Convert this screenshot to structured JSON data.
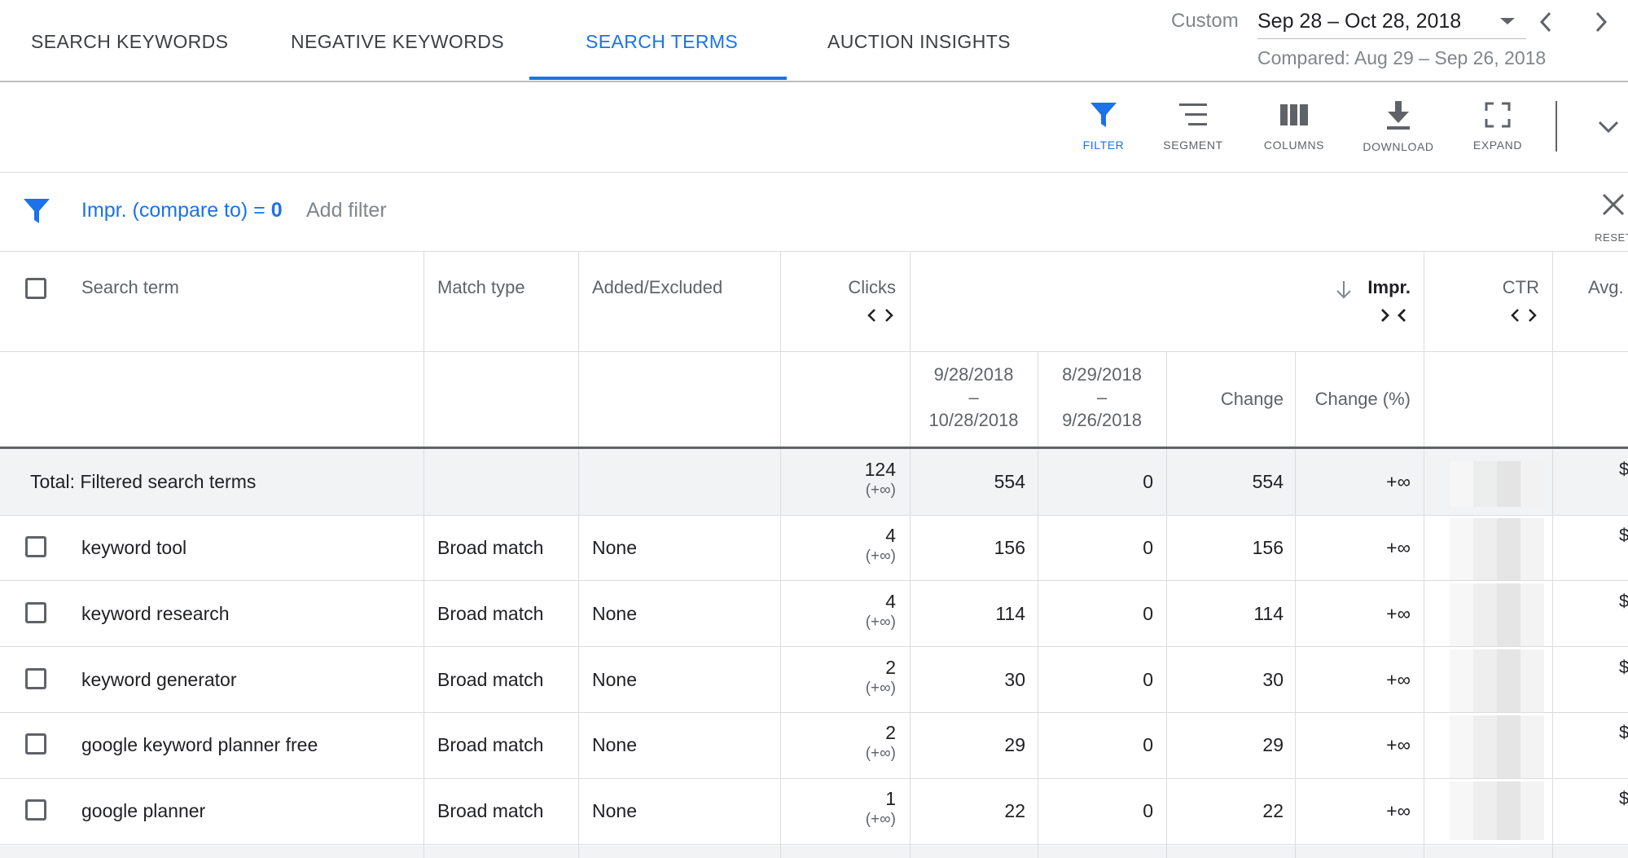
{
  "tabs": [
    {
      "label": "SEARCH KEYWORDS",
      "active": false
    },
    {
      "label": "NEGATIVE KEYWORDS",
      "active": false
    },
    {
      "label": "SEARCH TERMS",
      "active": true
    },
    {
      "label": "AUCTION INSIGHTS",
      "active": false
    }
  ],
  "date": {
    "preset": "Custom",
    "range": "Sep 28 – Oct 28, 2018",
    "compared": "Compared: Aug 29 – Sep 26, 2018"
  },
  "toolbar": {
    "filter": "FILTER",
    "segment": "SEGMENT",
    "columns": "COLUMNS",
    "download": "DOWNLOAD",
    "expand": "EXPAND"
  },
  "filter_bar": {
    "chip_prefix": "Impr. (compare to) = ",
    "chip_value": "0",
    "add_filter": "Add filter",
    "reset": "RESET"
  },
  "table": {
    "headers": {
      "search_term": "Search term",
      "match_type": "Match type",
      "added_excluded": "Added/Excluded",
      "clicks": "Clicks",
      "impr": "Impr.",
      "ctr": "CTR",
      "avg": "Avg."
    },
    "subheaders": {
      "current_start": "9/28/2018",
      "current_end": "10/28/2018",
      "prev_start": "8/29/2018",
      "prev_end": "9/26/2018",
      "dash": "–",
      "change": "Change",
      "change_pct": "Change (%)"
    },
    "total": {
      "label": "Total: Filtered search terms",
      "clicks": "124",
      "clicks_change": "(+∞)",
      "impr_current": "554",
      "impr_prev": "0",
      "impr_change": "554",
      "impr_change_pct": "+∞",
      "avg": "$"
    },
    "rows": [
      {
        "term": "keyword tool",
        "match": "Broad match",
        "added": "None",
        "clicks": "4",
        "clicks_change": "(+∞)",
        "impr_current": "156",
        "impr_prev": "0",
        "impr_change": "156",
        "impr_change_pct": "+∞",
        "avg": "$"
      },
      {
        "term": "keyword research",
        "match": "Broad match",
        "added": "None",
        "clicks": "4",
        "clicks_change": "(+∞)",
        "impr_current": "114",
        "impr_prev": "0",
        "impr_change": "114",
        "impr_change_pct": "+∞",
        "avg": "$"
      },
      {
        "term": "keyword generator",
        "match": "Broad match",
        "added": "None",
        "clicks": "2",
        "clicks_change": "(+∞)",
        "impr_current": "30",
        "impr_prev": "0",
        "impr_change": "30",
        "impr_change_pct": "+∞",
        "avg": "$"
      },
      {
        "term": "google keyword planner free",
        "match": "Broad match",
        "added": "None",
        "clicks": "2",
        "clicks_change": "(+∞)",
        "impr_current": "29",
        "impr_prev": "0",
        "impr_change": "29",
        "impr_change_pct": "+∞",
        "avg": "$"
      },
      {
        "term": "google planner",
        "match": "Broad match",
        "added": "None",
        "clicks": "1",
        "clicks_change": "(+∞)",
        "impr_current": "22",
        "impr_prev": "0",
        "impr_change": "22",
        "impr_change_pct": "+∞",
        "avg": "$"
      }
    ]
  },
  "colors": {
    "accent": "#1a73e8",
    "text": "#202124",
    "muted": "#5f6368",
    "divider": "#dadce0",
    "total_bg": "#f1f3f4"
  }
}
